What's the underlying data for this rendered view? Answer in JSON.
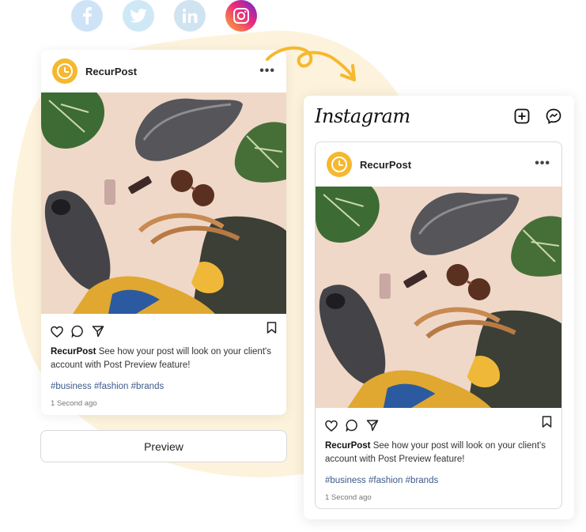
{
  "social": {
    "items": [
      {
        "name": "facebook",
        "icon": "facebook-icon"
      },
      {
        "name": "twitter",
        "icon": "twitter-icon"
      },
      {
        "name": "linkedin",
        "icon": "linkedin-icon"
      },
      {
        "name": "instagram",
        "icon": "instagram-icon"
      }
    ]
  },
  "post": {
    "account": "RecurPost",
    "caption_user": "RecurPost",
    "caption_text": " See how your post will look on your client's account with Post Preview feature!",
    "hashtags": "#business #fashion #brands",
    "timestamp": "1 Second ago"
  },
  "preview_button": {
    "label": "Preview"
  },
  "instagram": {
    "logo": "Instagram"
  },
  "colors": {
    "accent": "#f5b82e",
    "hashtag": "#3b5b8a",
    "blob": "#fdf3dc"
  }
}
